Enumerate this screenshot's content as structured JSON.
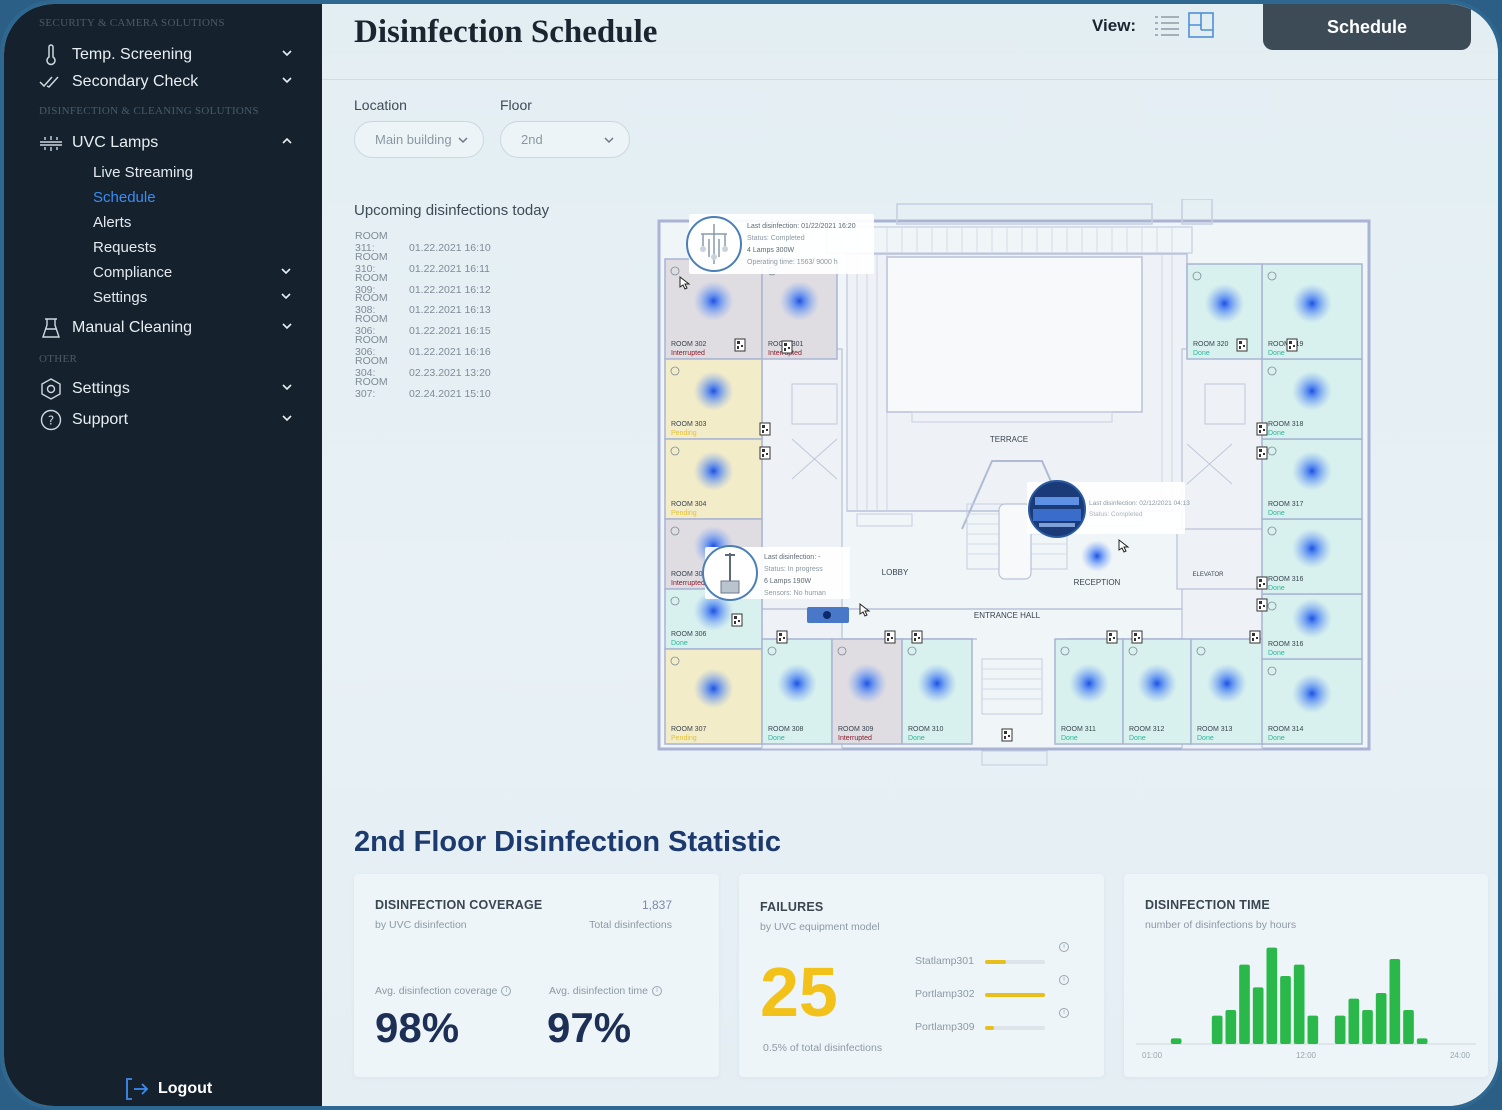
{
  "sidebar": {
    "sections": {
      "top": "SECURITY & CAMERA SOLUTIONS",
      "disinfection": "DISINFECTION & CLEANING SOLUTIONS",
      "other": "OTHER"
    },
    "items": [
      {
        "label": "Temp. Screening",
        "icon": "thermometer-icon"
      },
      {
        "label": "Secondary Check",
        "icon": "double-check-icon"
      },
      {
        "label": "UVC Lamps",
        "icon": "uvc-lamp-icon"
      },
      {
        "label": "Manual Cleaning",
        "icon": "cleaning-flask-icon"
      },
      {
        "label": "Settings",
        "icon": "settings-icon"
      },
      {
        "label": "Support",
        "icon": "help-icon"
      }
    ],
    "uvc_sub": [
      "Live Streaming",
      "Schedule",
      "Alerts",
      "Requests",
      "Compliance",
      "Settings"
    ],
    "active_sub": "Schedule",
    "logout": "Logout"
  },
  "header": {
    "title": "Disinfection Schedule",
    "view_label": "View:",
    "schedule_button": "Schedule"
  },
  "filters": {
    "location_label": "Location",
    "location_value": "Main building",
    "floor_label": "Floor",
    "floor_value": "2nd"
  },
  "upcoming": {
    "title": "Upcoming disinfections today",
    "rows": [
      {
        "room": "ROOM 311:",
        "time": "01.22.2021  16:10"
      },
      {
        "room": "ROOM 310:",
        "time": "01.22.2021  16:11"
      },
      {
        "room": "ROOM 309:",
        "time": "01.22.2021  16:12"
      },
      {
        "room": "ROOM 308:",
        "time": "01.22.2021  16:13"
      },
      {
        "room": "ROOM 306:",
        "time": "01.22.2021  16:15"
      },
      {
        "room": "ROOM 306:",
        "time": "01.22.2021  16:16"
      },
      {
        "room": "ROOM 304:",
        "time": "02.23.2021  13:20"
      },
      {
        "room": "ROOM 307:",
        "time": "02.24.2021  15:10"
      }
    ]
  },
  "floorplan": {
    "labels": {
      "terrace": "TERRACE",
      "lobby": "LOBBY",
      "reception": "RECEPTION",
      "entrance": "ENTRANCE HALL",
      "elevator": "ELEVATOR"
    },
    "status_colors": {
      "Done": "#2bb59a",
      "Interrupted": "#8a1c2c",
      "Pending": "#e2c23a"
    },
    "rooms": [
      {
        "name": "ROOM 302",
        "status": "Interrupted"
      },
      {
        "name": "ROOM 301",
        "status": "Interrupted"
      },
      {
        "name": "ROOM 303",
        "status": "Pending"
      },
      {
        "name": "ROOM 304",
        "status": "Pending"
      },
      {
        "name": "ROOM 305",
        "status": "Interrupted"
      },
      {
        "name": "ROOM 306",
        "status": "Done"
      },
      {
        "name": "ROOM 307",
        "status": "Pending"
      },
      {
        "name": "ROOM 308",
        "status": "Done"
      },
      {
        "name": "ROOM 309",
        "status": "Interrupted"
      },
      {
        "name": "ROOM 310",
        "status": "Done"
      },
      {
        "name": "ROOM 311",
        "status": "Done"
      },
      {
        "name": "ROOM 312",
        "status": "Done"
      },
      {
        "name": "ROOM 313",
        "status": "Done"
      },
      {
        "name": "ROOM 314",
        "status": "Done"
      },
      {
        "name": "ROOM 316",
        "status": "Done"
      },
      {
        "name": "ROOM 316",
        "status": "Done"
      },
      {
        "name": "ROOM 317",
        "status": "Done"
      },
      {
        "name": "ROOM 318",
        "status": "Done"
      },
      {
        "name": "ROOM 319",
        "status": "Done"
      },
      {
        "name": "ROOM 320",
        "status": "Done"
      }
    ],
    "popups": [
      {
        "lines": [
          "Last disinfection: 01/22/2021 16:20",
          "Status: Completed",
          "4 Lamps 300W",
          "Operating time: 1563/ 9000 h"
        ]
      },
      {
        "lines": [
          "Last disinfection: -",
          "Status: In progress",
          "6 Lamps 190W",
          "Sensors: No human"
        ]
      },
      {
        "lines": [
          "Last disinfection: 02/12/2021 04:13",
          "Status: Completed"
        ]
      }
    ]
  },
  "stats": {
    "title": "2nd Floor Disinfection Statistic",
    "coverage": {
      "title": "DISINFECTION COVERAGE",
      "sub": "by UVC disinfection",
      "total_value": "1,837",
      "total_label": "Total disinfections",
      "avg_coverage_label": "Avg. disinfection coverage",
      "avg_coverage_value": "98%",
      "avg_time_label": "Avg. disinfection time",
      "avg_time_value": "97%"
    },
    "failures": {
      "title": "FAILURES",
      "sub": "by UVC equipment model",
      "value": "25",
      "note": "0.5% of total disinfections",
      "rows": [
        {
          "name": "Statlamp301",
          "fraction": 0.35
        },
        {
          "name": "Portlamp302",
          "fraction": 1.0
        },
        {
          "name": "Portlamp309",
          "fraction": 0.15
        }
      ]
    },
    "time": {
      "title": "DISINFECTION TIME",
      "sub": "number of disinfections by hours",
      "x_ticks": [
        "01:00",
        "12:00",
        "24:00"
      ],
      "bar_color": "#2bb84a"
    }
  },
  "chart_data": {
    "type": "bar",
    "title": "DISINFECTION TIME",
    "subtitle": "number of disinfections by hours",
    "x_tick_labels": [
      "01:00",
      "12:00",
      "24:00"
    ],
    "categories": [
      "01",
      "02",
      "03",
      "04",
      "05",
      "06",
      "07",
      "08",
      "09",
      "10",
      "11",
      "12",
      "13",
      "14",
      "15",
      "16",
      "17",
      "18",
      "19",
      "20",
      "21",
      "22",
      "23",
      "24"
    ],
    "values": [
      0,
      0,
      1,
      0,
      0,
      5,
      6,
      14,
      10,
      17,
      12,
      14,
      5,
      0,
      5,
      8,
      6,
      9,
      15,
      6,
      1,
      0,
      0,
      0
    ],
    "ylim": [
      0,
      18
    ]
  }
}
